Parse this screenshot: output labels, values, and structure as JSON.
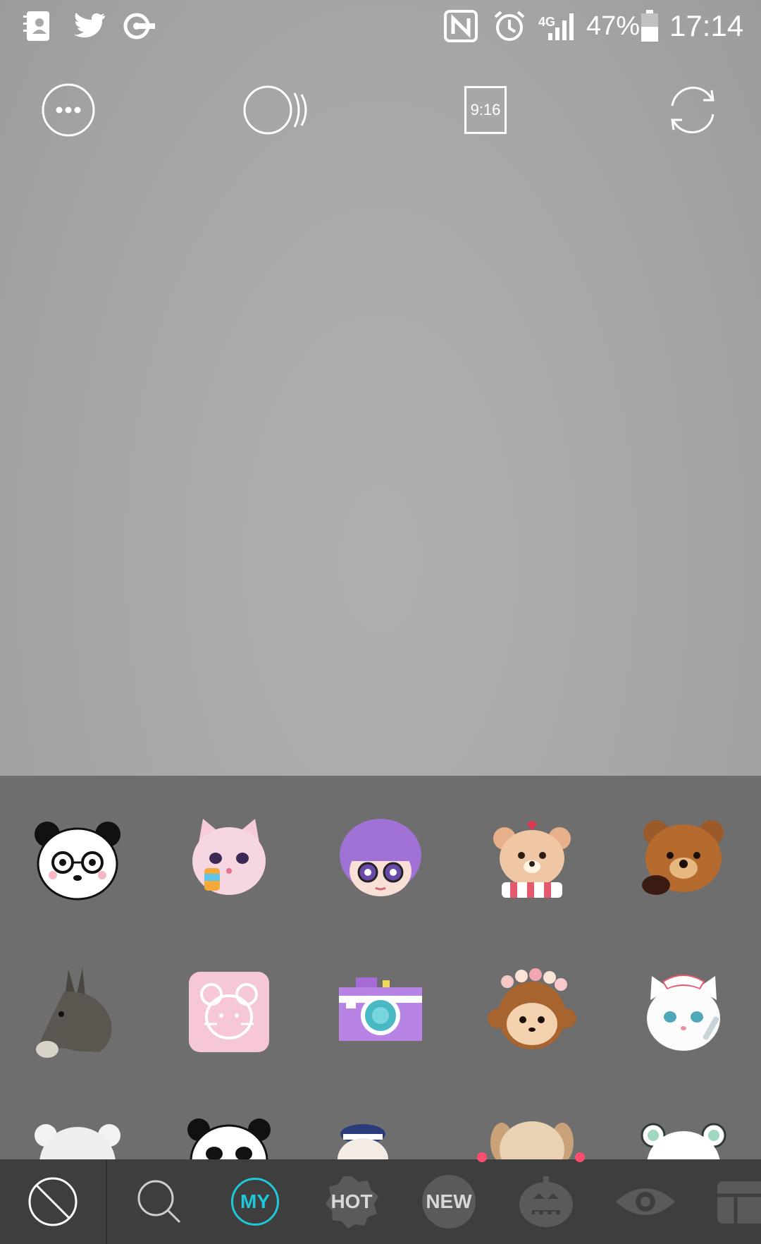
{
  "status_bar": {
    "network": "4G",
    "battery": "47%",
    "time": "17:14"
  },
  "toolbar": {
    "ratio_label": "9:16"
  },
  "tabs": {
    "my": "MY",
    "hot": "HOT",
    "new": "NEW"
  },
  "colors": {
    "accent": "#1ec8d8",
    "notify": "#ff4d6d",
    "panel": "#6e6e6e",
    "tabbar": "#3e3e3e"
  },
  "stickers": [
    "panda-glasses-icon",
    "pink-cat-icecream-icon",
    "purple-hair-girl-icon",
    "teddy-bear-scarf-icon",
    "brown-bear-icon",
    "donkey-icon",
    "pink-mouse-tile-icon",
    "pixel-camera-icon",
    "monkey-flower-crown-icon",
    "white-cat-nurse-icon",
    "white-bear-icon",
    "panda-leaf-icon",
    "sailor-cat-icon",
    "puppy-icon",
    "mint-bear-icon"
  ]
}
